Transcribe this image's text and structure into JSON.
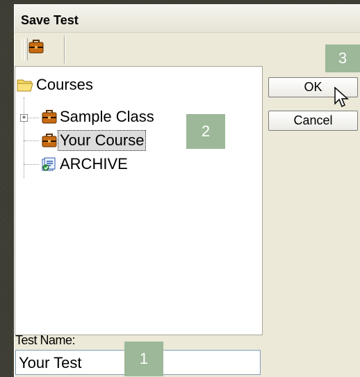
{
  "dialog": {
    "title": "Save Test",
    "ok_label": "OK",
    "cancel_label": "Cancel",
    "test_name_label": "Test Name:",
    "test_name_value": "Your Test"
  },
  "tree": {
    "root": {
      "label": "Courses",
      "icon": "folder-open-icon"
    },
    "items": [
      {
        "label": "Sample Class",
        "icon": "briefcase-icon",
        "expandable": true
      },
      {
        "label": "Your Course",
        "icon": "briefcase-icon",
        "selected": true
      },
      {
        "label": "ARCHIVE",
        "icon": "archive-icon"
      }
    ]
  },
  "callouts": [
    "1",
    "2",
    "3"
  ],
  "colors": {
    "dialog_bg": "#ece9d8",
    "callout_bg": "#9cb898",
    "selection_bg": "#dcdcdc"
  }
}
